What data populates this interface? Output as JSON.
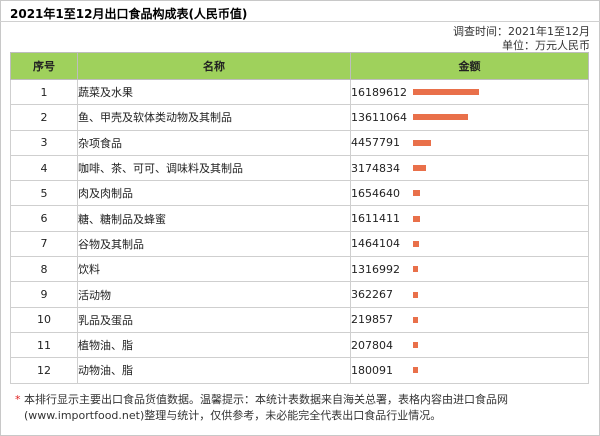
{
  "page_title": "2021年1至12月出口食品构成表(人民币值)",
  "meta": {
    "survey_time_label": "调查时间：",
    "survey_time_value": "2021年1至12月",
    "unit_label": "单位：",
    "unit_value": "万元人民币"
  },
  "table": {
    "headers": {
      "rank": "序号",
      "name": "名称",
      "value": "金额"
    },
    "max_value": 16189612,
    "rows": [
      {
        "rank": "1",
        "name": "蔬菜及水果",
        "value": 16189612
      },
      {
        "rank": "2",
        "name": "鱼、甲壳及软体类动物及其制品",
        "value": 13611064
      },
      {
        "rank": "3",
        "name": "杂项食品",
        "value": 4457791
      },
      {
        "rank": "4",
        "name": "咖啡、茶、可可、调味料及其制品",
        "value": 3174834
      },
      {
        "rank": "5",
        "name": "肉及肉制品",
        "value": 1654640
      },
      {
        "rank": "6",
        "name": "糖、糖制品及蜂蜜",
        "value": 1611411
      },
      {
        "rank": "7",
        "name": "谷物及其制品",
        "value": 1464104
      },
      {
        "rank": "8",
        "name": "饮料",
        "value": 1316992
      },
      {
        "rank": "9",
        "name": "活动物",
        "value": 362267
      },
      {
        "rank": "10",
        "name": "乳品及蛋品",
        "value": 219857
      },
      {
        "rank": "11",
        "name": "植物油、脂",
        "value": 207804
      },
      {
        "rank": "12",
        "name": "动物油、脂",
        "value": 180091
      }
    ]
  },
  "bar_color": "#e9704a",
  "header_color": "#9fd15c",
  "footnote": {
    "star": "*",
    "text": "本排行显示主要出口食品货值数据。温馨提示：本统计表数据来自海关总署，表格内容由进口食品网(www.importfood.net)整理与统计，仅供参考，未必能完全代表出口食品行业情况。"
  }
}
